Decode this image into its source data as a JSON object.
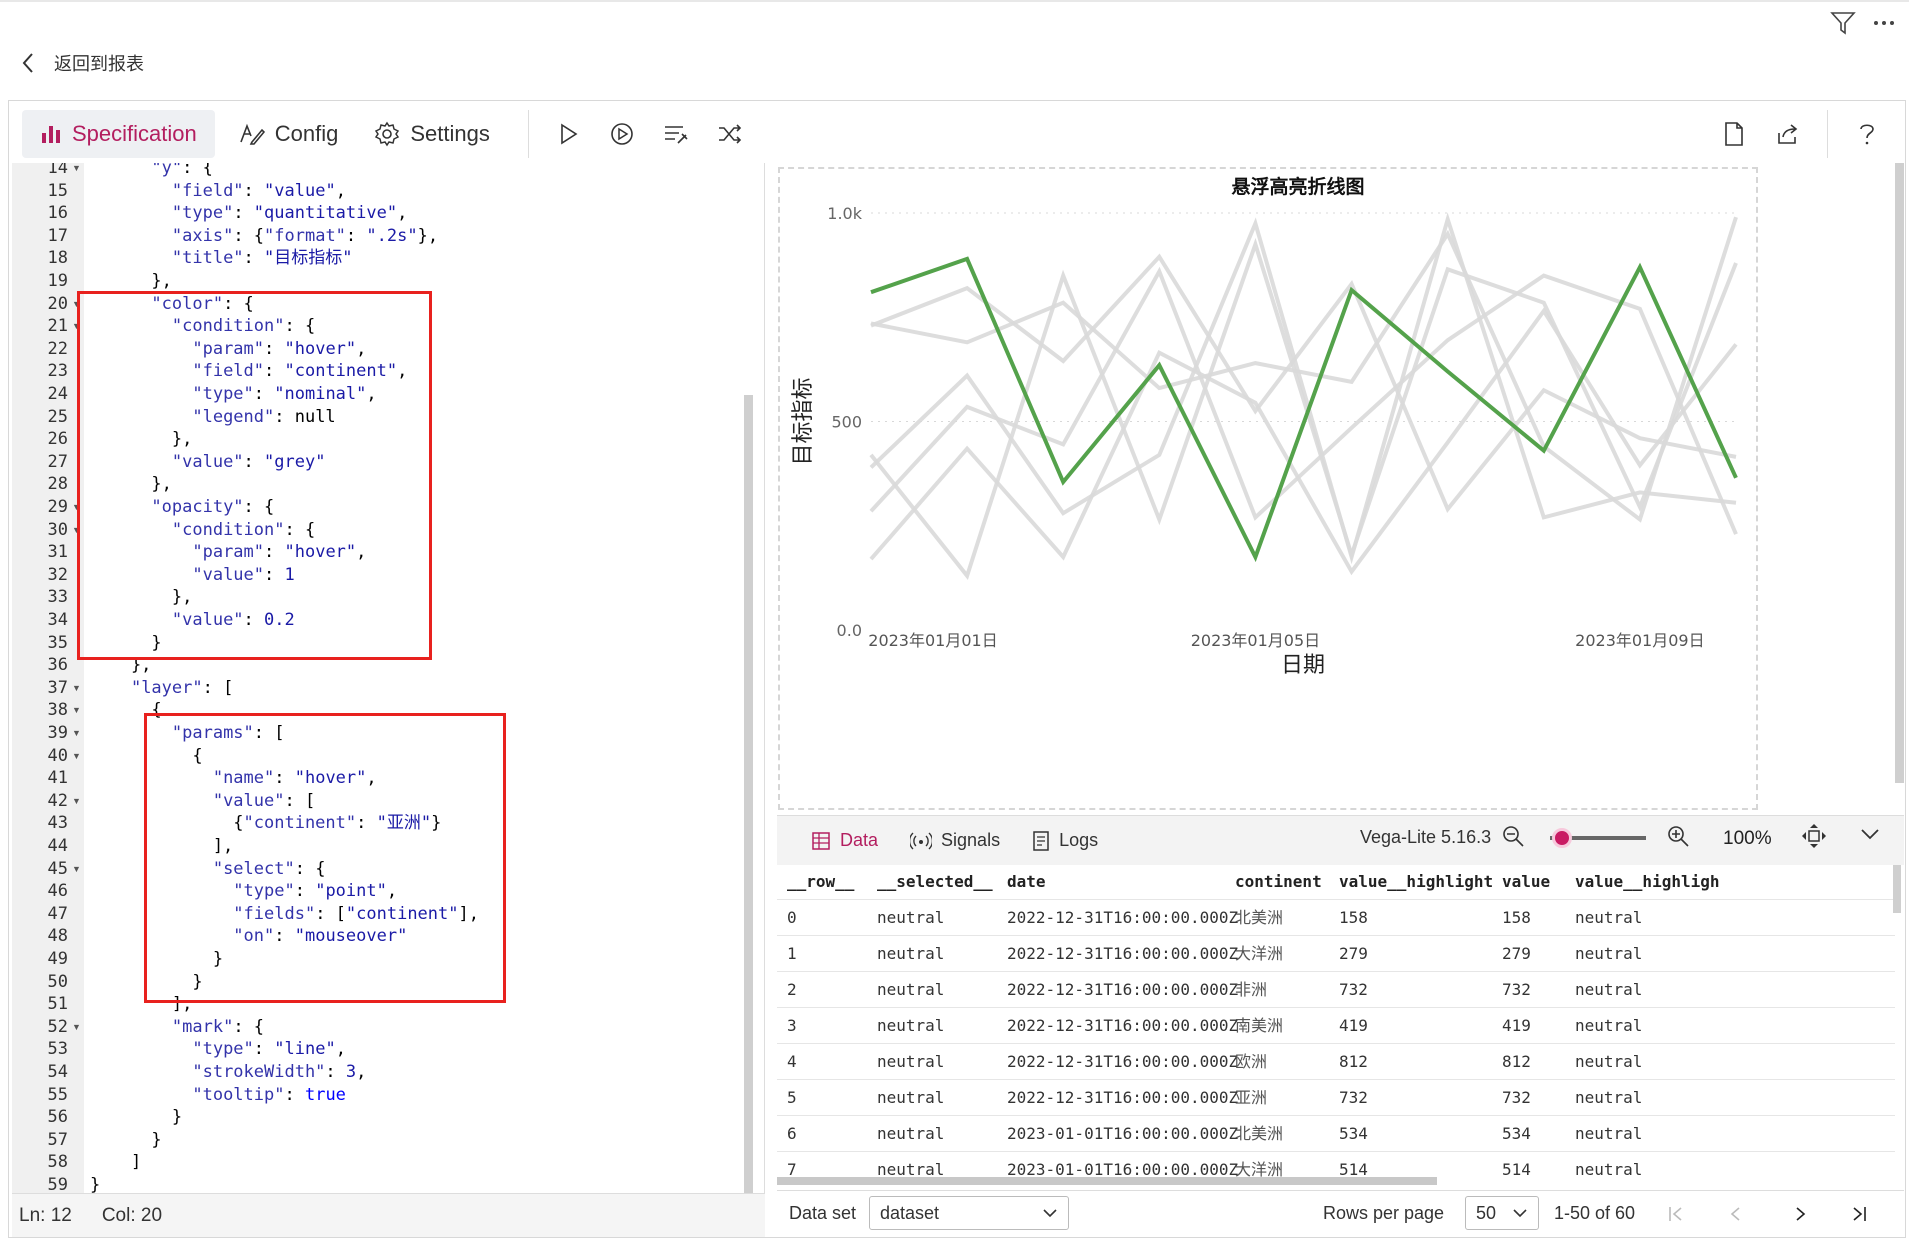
{
  "back": {
    "label": "返回到报表"
  },
  "toolbar": {
    "tabs": [
      {
        "label": "Specification"
      },
      {
        "label": "Config"
      },
      {
        "label": "Settings"
      }
    ]
  },
  "editor": {
    "lines": [
      {
        "n": "14",
        "fold": true,
        "text": "      \"y\": {"
      },
      {
        "n": "15",
        "fold": false,
        "text": "        \"field\": \"value\","
      },
      {
        "n": "16",
        "fold": false,
        "text": "        \"type\": \"quantitative\","
      },
      {
        "n": "17",
        "fold": false,
        "text": "        \"axis\": {\"format\": \".2s\"},"
      },
      {
        "n": "18",
        "fold": false,
        "text": "        \"title\": \"目标指标\""
      },
      {
        "n": "19",
        "fold": false,
        "text": "      },"
      },
      {
        "n": "20",
        "fold": true,
        "text": "      \"color\": {"
      },
      {
        "n": "21",
        "fold": true,
        "text": "        \"condition\": {"
      },
      {
        "n": "22",
        "fold": false,
        "text": "          \"param\": \"hover\","
      },
      {
        "n": "23",
        "fold": false,
        "text": "          \"field\": \"continent\","
      },
      {
        "n": "24",
        "fold": false,
        "text": "          \"type\": \"nominal\","
      },
      {
        "n": "25",
        "fold": false,
        "text": "          \"legend\": null"
      },
      {
        "n": "26",
        "fold": false,
        "text": "        },"
      },
      {
        "n": "27",
        "fold": false,
        "text": "        \"value\": \"grey\""
      },
      {
        "n": "28",
        "fold": false,
        "text": "      },"
      },
      {
        "n": "29",
        "fold": true,
        "text": "      \"opacity\": {"
      },
      {
        "n": "30",
        "fold": true,
        "text": "        \"condition\": {"
      },
      {
        "n": "31",
        "fold": false,
        "text": "          \"param\": \"hover\","
      },
      {
        "n": "32",
        "fold": false,
        "text": "          \"value\": 1"
      },
      {
        "n": "33",
        "fold": false,
        "text": "        },"
      },
      {
        "n": "34",
        "fold": false,
        "text": "        \"value\": 0.2"
      },
      {
        "n": "35",
        "fold": false,
        "text": "      }"
      },
      {
        "n": "36",
        "fold": false,
        "text": "    },"
      },
      {
        "n": "37",
        "fold": true,
        "text": "    \"layer\": ["
      },
      {
        "n": "38",
        "fold": true,
        "text": "      {"
      },
      {
        "n": "39",
        "fold": true,
        "text": "        \"params\": ["
      },
      {
        "n": "40",
        "fold": true,
        "text": "          {"
      },
      {
        "n": "41",
        "fold": false,
        "text": "            \"name\": \"hover\","
      },
      {
        "n": "42",
        "fold": true,
        "text": "            \"value\": ["
      },
      {
        "n": "43",
        "fold": false,
        "text": "              {\"continent\": \"亚洲\"}"
      },
      {
        "n": "44",
        "fold": false,
        "text": "            ],"
      },
      {
        "n": "45",
        "fold": true,
        "text": "            \"select\": {"
      },
      {
        "n": "46",
        "fold": false,
        "text": "              \"type\": \"point\","
      },
      {
        "n": "47",
        "fold": false,
        "text": "              \"fields\": [\"continent\"],"
      },
      {
        "n": "48",
        "fold": false,
        "text": "              \"on\": \"mouseover\""
      },
      {
        "n": "49",
        "fold": false,
        "text": "            }"
      },
      {
        "n": "50",
        "fold": false,
        "text": "          }"
      },
      {
        "n": "51",
        "fold": false,
        "text": "        ],"
      },
      {
        "n": "52",
        "fold": true,
        "text": "        \"mark\": {"
      },
      {
        "n": "53",
        "fold": false,
        "text": "          \"type\": \"line\","
      },
      {
        "n": "54",
        "fold": false,
        "text": "          \"strokeWidth\": 3,"
      },
      {
        "n": "55",
        "fold": false,
        "text": "          \"tooltip\": true"
      },
      {
        "n": "56",
        "fold": false,
        "text": "        }"
      },
      {
        "n": "57",
        "fold": false,
        "text": "      }"
      },
      {
        "n": "58",
        "fold": false,
        "text": "    ]"
      },
      {
        "n": "59",
        "fold": false,
        "text": "}"
      }
    ]
  },
  "status": {
    "ln": "Ln: 12",
    "col": "Col: 20"
  },
  "chart_data": {
    "type": "line",
    "title": "悬浮高亮折线图",
    "xlabel": "日期",
    "ylabel": "目标指标",
    "x_ticks": [
      "2023年01月01日",
      "2023年01月05日",
      "2023年01月09日"
    ],
    "y_ticks": [
      "0.0",
      "500",
      "1.0k"
    ],
    "ylim": [
      0,
      1000
    ],
    "x": [
      "2023-01-01",
      "2023-01-02",
      "2023-01-03",
      "2023-01-04",
      "2023-01-05",
      "2023-01-06",
      "2023-01-07",
      "2023-01-08",
      "2023-01-09",
      "2023-01-10"
    ],
    "highlight_color": "#54a24b",
    "base_color": "#d9d9d9",
    "series": [
      {
        "highlight": true,
        "values": [
          810,
          890,
          355,
          635,
          175,
          815,
          620,
          430,
          870,
          365
        ]
      },
      {
        "highlight": false,
        "values": [
          735,
          690,
          785,
          580,
          640,
          595,
          950,
          440,
          265,
          990
        ]
      },
      {
        "highlight": false,
        "values": [
          285,
          535,
          445,
          860,
          270,
          485,
          695,
          850,
          770,
          230
        ]
      },
      {
        "highlight": false,
        "values": [
          170,
          435,
          175,
          665,
          545,
          140,
          450,
          765,
          395,
          685
        ]
      },
      {
        "highlight": false,
        "values": [
          420,
          130,
          850,
          265,
          925,
          180,
          865,
          785,
          295,
          880
        ]
      },
      {
        "highlight": false,
        "values": [
          730,
          820,
          645,
          895,
          525,
          830,
          290,
          575,
          460,
          415
        ]
      },
      {
        "highlight": false,
        "values": [
          390,
          610,
          280,
          420,
          975,
          175,
          985,
          270,
          330,
          305
        ]
      }
    ]
  },
  "panel": {
    "tabs": [
      {
        "label": "Data"
      },
      {
        "label": "Signals"
      },
      {
        "label": "Logs"
      }
    ],
    "vega_version": "Vega-Lite 5.16.3",
    "zoom": "100%",
    "zoom_level": 0.33
  },
  "table": {
    "columns": [
      "__row__",
      "__selected__",
      "date",
      "continent",
      "value__highlight",
      "value",
      "value__highligh"
    ],
    "rows": [
      [
        "0",
        "neutral",
        "2022-12-31T16:00:00.000Z",
        "北美洲",
        "158",
        "158",
        "neutral"
      ],
      [
        "1",
        "neutral",
        "2022-12-31T16:00:00.000Z",
        "大洋洲",
        "279",
        "279",
        "neutral"
      ],
      [
        "2",
        "neutral",
        "2022-12-31T16:00:00.000Z",
        "非洲",
        "732",
        "732",
        "neutral"
      ],
      [
        "3",
        "neutral",
        "2022-12-31T16:00:00.000Z",
        "南美洲",
        "419",
        "419",
        "neutral"
      ],
      [
        "4",
        "neutral",
        "2022-12-31T16:00:00.000Z",
        "欧洲",
        "812",
        "812",
        "neutral"
      ],
      [
        "5",
        "neutral",
        "2022-12-31T16:00:00.000Z",
        "亚洲",
        "732",
        "732",
        "neutral"
      ],
      [
        "6",
        "neutral",
        "2023-01-01T16:00:00.000Z",
        "北美洲",
        "534",
        "534",
        "neutral"
      ],
      [
        "7",
        "neutral",
        "2023-01-01T16:00:00.000Z",
        "大洋洲",
        "514",
        "514",
        "neutral"
      ]
    ]
  },
  "pager": {
    "dataset_label": "Data set",
    "dataset_value": "dataset",
    "rows_per_page_label": "Rows per page",
    "rows_per_page_value": "50",
    "range": "1-50 of 60"
  },
  "colors": {
    "accent": "#b31e5f",
    "highlight_box": "#e8211e"
  }
}
